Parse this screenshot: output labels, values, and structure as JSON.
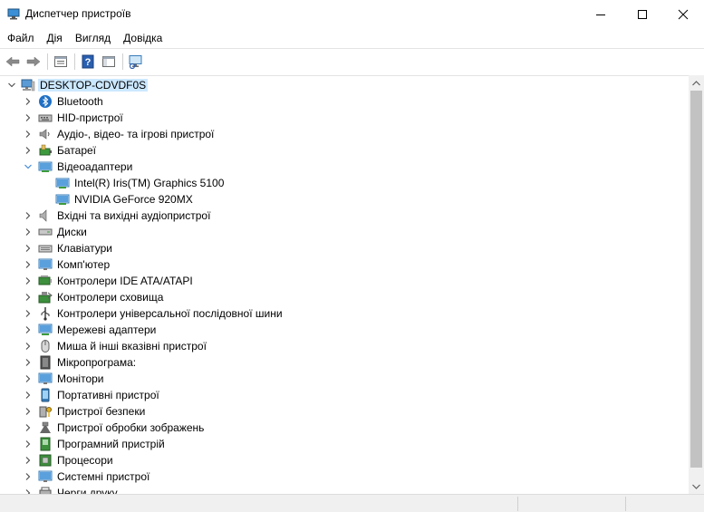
{
  "window": {
    "title": "Диспетчер пристроїв"
  },
  "menu": [
    "Файл",
    "Дія",
    "Вигляд",
    "Довідка"
  ],
  "toolbar": {
    "buttons": [
      "back-icon",
      "forward-icon",
      "properties-icon",
      "help-icon",
      "show-hide-tree-icon",
      "scan-hardware-icon"
    ]
  },
  "tree": {
    "root": "DESKTOP-CDVDF0S",
    "categories": [
      {
        "label": "Bluetooth",
        "icon": "bluetooth-icon",
        "expanded": false
      },
      {
        "label": "HID-пристрої",
        "icon": "hid-icon",
        "expanded": false
      },
      {
        "label": "Аудіо-, відео- та ігрові пристрої",
        "icon": "audio-video-icon",
        "expanded": false
      },
      {
        "label": "Батареї",
        "icon": "battery-icon",
        "expanded": false
      },
      {
        "label": "Відеоадаптери",
        "icon": "display-adapter-icon",
        "expanded": true,
        "children": [
          "Intel(R) Iris(TM) Graphics 5100",
          "NVIDIA GeForce 920MX"
        ]
      },
      {
        "label": "Вхідні та вихідні аудіопристрої",
        "icon": "speaker-icon",
        "expanded": false
      },
      {
        "label": "Диски",
        "icon": "disk-icon",
        "expanded": false
      },
      {
        "label": "Клавіатури",
        "icon": "keyboard-icon",
        "expanded": false
      },
      {
        "label": "Комп'ютер",
        "icon": "computer-icon",
        "expanded": false
      },
      {
        "label": "Контролери IDE ATA/ATAPI",
        "icon": "ide-controller-icon",
        "expanded": false
      },
      {
        "label": "Контролери сховища",
        "icon": "storage-controller-icon",
        "expanded": false
      },
      {
        "label": "Контролери універсальної послідовної шини",
        "icon": "usb-icon",
        "expanded": false
      },
      {
        "label": "Мережеві адаптери",
        "icon": "network-adapter-icon",
        "expanded": false
      },
      {
        "label": "Миша й інші вказівні пристрої",
        "icon": "mouse-icon",
        "expanded": false
      },
      {
        "label": "Мікропрограма:",
        "icon": "firmware-icon",
        "expanded": false
      },
      {
        "label": "Монітори",
        "icon": "monitor-icon",
        "expanded": false
      },
      {
        "label": "Портативні пристрої",
        "icon": "portable-device-icon",
        "expanded": false
      },
      {
        "label": "Пристрої безпеки",
        "icon": "security-device-icon",
        "expanded": false
      },
      {
        "label": "Пристрої обробки зображень",
        "icon": "camera-icon",
        "expanded": false
      },
      {
        "label": "Програмний пристрій",
        "icon": "software-device-icon",
        "expanded": false
      },
      {
        "label": "Процесори",
        "icon": "processor-icon",
        "expanded": false
      },
      {
        "label": "Системні пристрої",
        "icon": "system-device-icon",
        "expanded": false
      },
      {
        "label": "Черги друку",
        "icon": "print-queue-icon",
        "expanded": false
      }
    ]
  },
  "colors": {
    "selection": "#cce8ff",
    "accent": "#0078d7"
  }
}
